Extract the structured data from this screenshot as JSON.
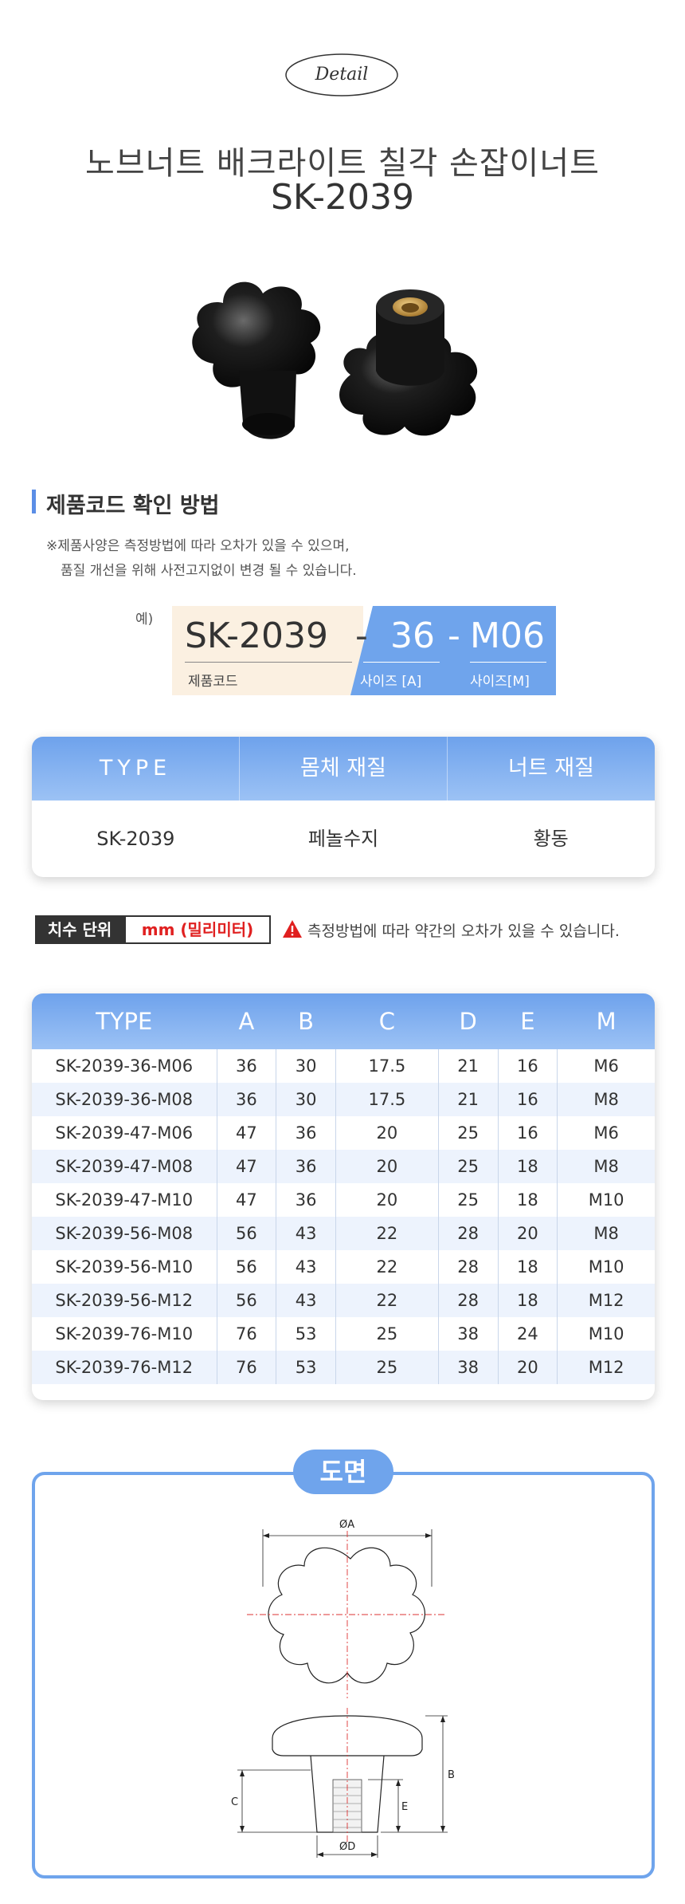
{
  "header": {
    "badge": "Detail",
    "title": "노브너트 배크라이트 칠각 손잡이너트",
    "model": "SK-2039"
  },
  "code_guide": {
    "title": "제품코드 확인 방법",
    "note_line1": "※제품사양은 측정방법에 따라 오차가 있을  수 있으며,",
    "note_line2": "품질 개선을 위해 사전고지없이 변경 될 수 있습니다.",
    "example_label": "예)",
    "code": "SK-2039",
    "code_caption": "제품코드",
    "dash": "-",
    "size": "36",
    "size_caption": "사이즈 [A]",
    "thread": "M06",
    "thread_caption": "사이즈[M]"
  },
  "material_table": {
    "headers": [
      "TYPE",
      "몸체 재질",
      "너트 재질"
    ],
    "row": [
      "SK-2039",
      "페놀수지",
      "황동"
    ]
  },
  "unit": {
    "label": "치수 단위",
    "value": "mm (밀리미터)",
    "warning": "측정방법에 따라 약간의 오차가 있을 수 있습니다."
  },
  "dimension_table": {
    "headers": [
      "TYPE",
      "A",
      "B",
      "C",
      "D",
      "E",
      "M"
    ],
    "rows": [
      [
        "SK-2039-36-M06",
        "36",
        "30",
        "17.5",
        "21",
        "16",
        "M6"
      ],
      [
        "SK-2039-36-M08",
        "36",
        "30",
        "17.5",
        "21",
        "16",
        "M8"
      ],
      [
        "SK-2039-47-M06",
        "47",
        "36",
        "20",
        "25",
        "16",
        "M6"
      ],
      [
        "SK-2039-47-M08",
        "47",
        "36",
        "20",
        "25",
        "18",
        "M8"
      ],
      [
        "SK-2039-47-M10",
        "47",
        "36",
        "20",
        "25",
        "18",
        "M10"
      ],
      [
        "SK-2039-56-M08",
        "56",
        "43",
        "22",
        "28",
        "20",
        "M8"
      ],
      [
        "SK-2039-56-M10",
        "56",
        "43",
        "22",
        "28",
        "18",
        "M10"
      ],
      [
        "SK-2039-56-M12",
        "56",
        "43",
        "22",
        "28",
        "18",
        "M12"
      ],
      [
        "SK-2039-76-M10",
        "76",
        "53",
        "25",
        "38",
        "24",
        "M10"
      ],
      [
        "SK-2039-76-M12",
        "76",
        "53",
        "25",
        "38",
        "20",
        "M12"
      ]
    ]
  },
  "drawing": {
    "title": "도면",
    "label_a": "ØA",
    "label_b": "B",
    "label_c": "C",
    "label_d": "ØD",
    "label_e": "E"
  },
  "colors": {
    "accent_blue": "#6fa4ec",
    "warning_red": "#e02020",
    "row_tint": "#edf3fd"
  }
}
